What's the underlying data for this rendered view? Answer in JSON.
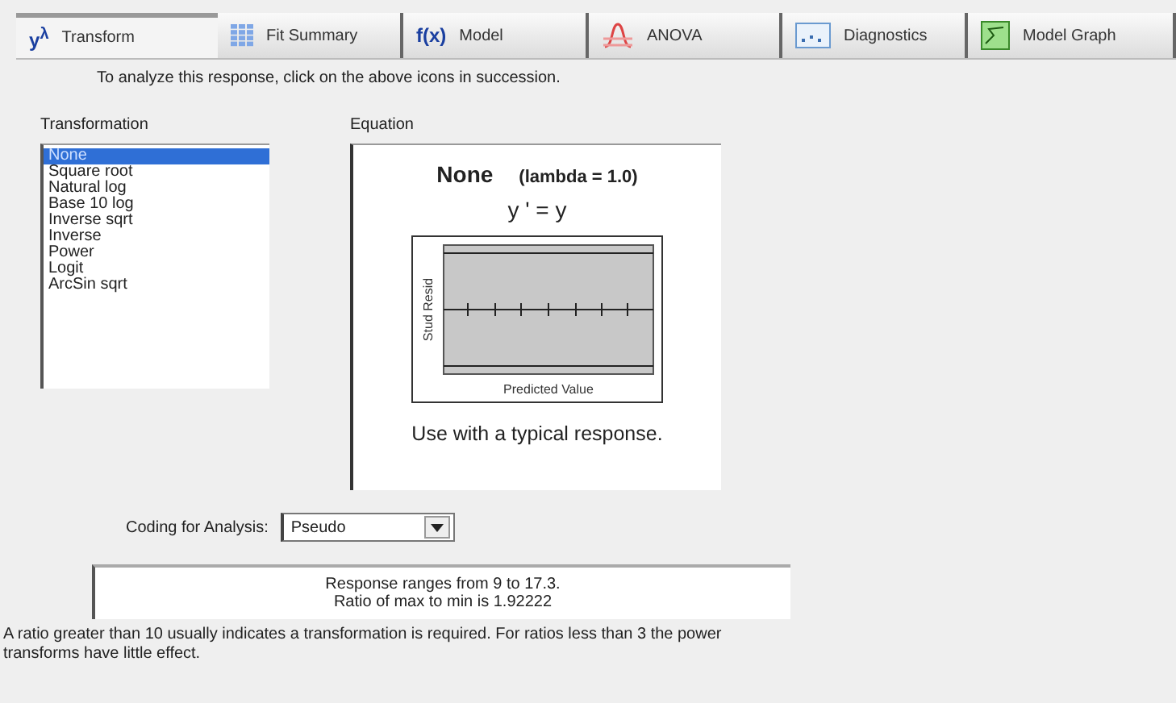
{
  "tabs": [
    {
      "kind": "text",
      "icon_text": "y$^{λ}$",
      "label": "Transform",
      "selected": true
    },
    {
      "kind": "grid",
      "label": "Fit Summary",
      "selected": false
    },
    {
      "kind": "text",
      "icon_text": "f(x)",
      "label": "Model",
      "selected": false
    },
    {
      "kind": "bell",
      "label": "ANOVA",
      "selected": false
    },
    {
      "kind": "chart",
      "label": "Diagnostics",
      "selected": false
    },
    {
      "kind": "graph",
      "label": "Model Graph",
      "selected": false
    }
  ],
  "instruction": "To analyze this response, click on the above icons in succession.",
  "transformation": {
    "label": "Transformation",
    "items": [
      {
        "label": "None",
        "selected": true
      },
      {
        "label": "Square root",
        "selected": false
      },
      {
        "label": "Natural log",
        "selected": false
      },
      {
        "label": "Base 10 log",
        "selected": false
      },
      {
        "label": "Inverse sqrt",
        "selected": false
      },
      {
        "label": "Inverse",
        "selected": false
      },
      {
        "label": "Power",
        "selected": false
      },
      {
        "label": "Logit",
        "selected": false
      },
      {
        "label": "ArcSin sqrt",
        "selected": false
      }
    ]
  },
  "equation": {
    "label": "Equation",
    "name": "None",
    "lambda": "(lambda = 1.0)",
    "formula": "y ' = y",
    "plot_ylabel": "Stud Resid",
    "plot_xlabel": "Predicted Value",
    "note": "Use with a typical response."
  },
  "coding": {
    "label": "Coding for Analysis:",
    "value": "Pseudo"
  },
  "info": [
    "Response ranges from 9 to 17.3.",
    "Ratio of max to min is 1.92222"
  ],
  "footnote": "A ratio greater than 10 usually indicates a transformation is required.  For ratios less than 3 the power transforms have little effect."
}
